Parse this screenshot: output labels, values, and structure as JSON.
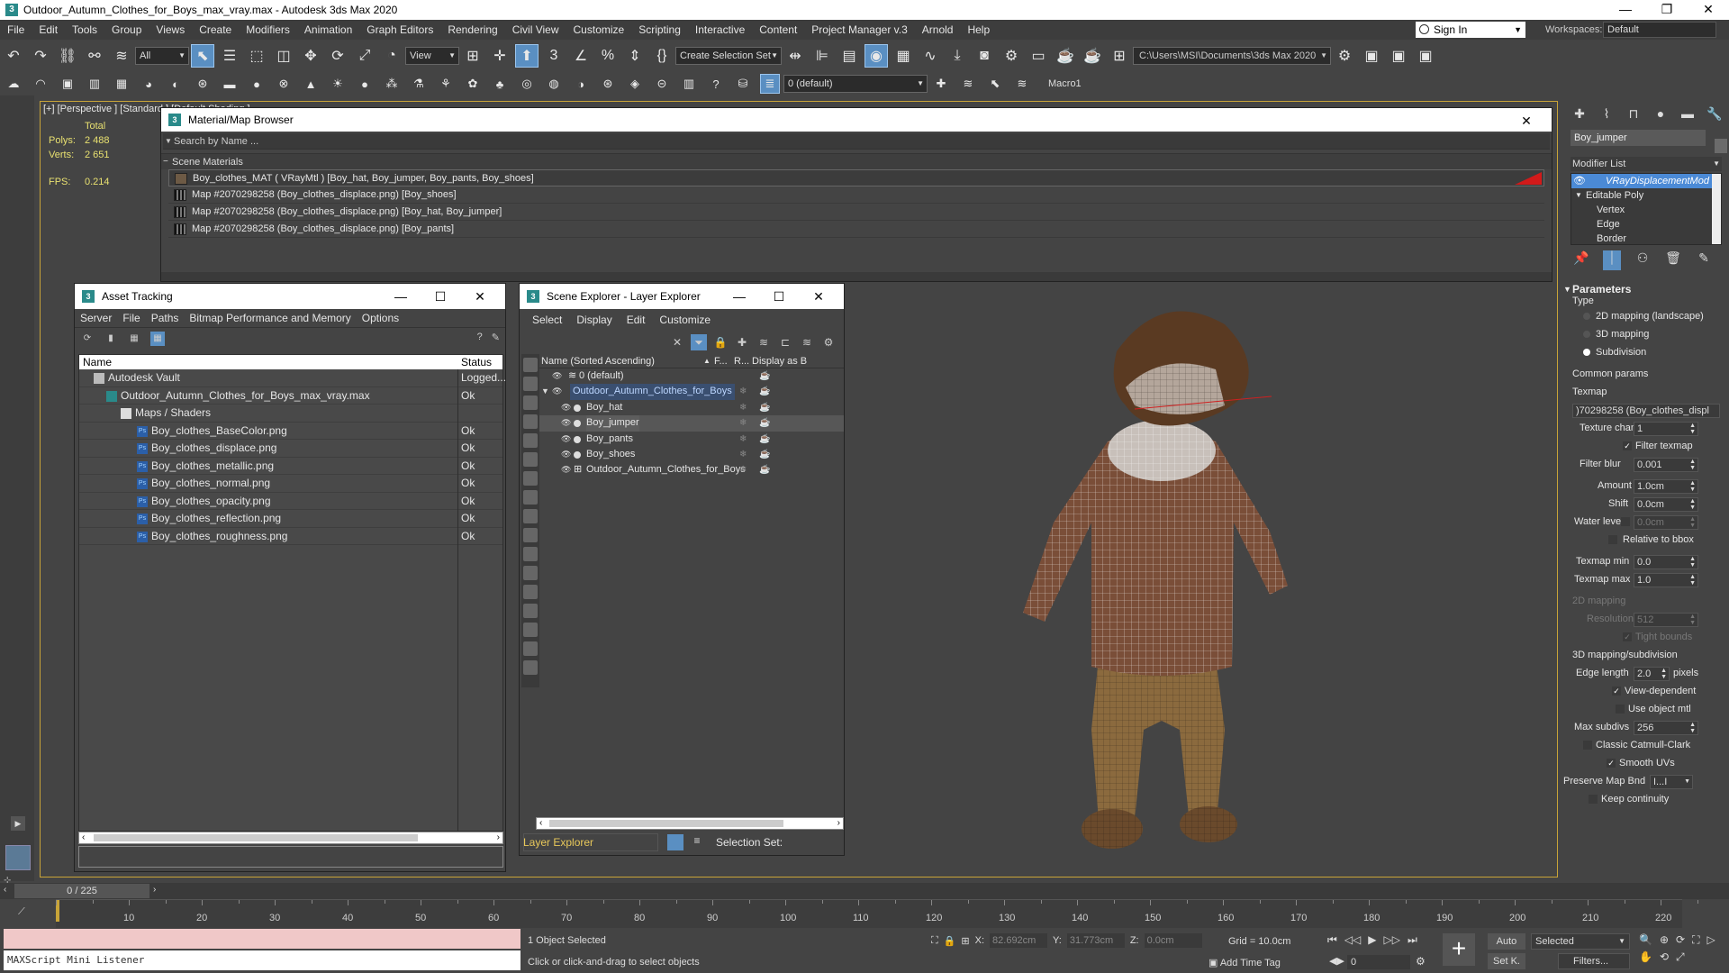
{
  "window": {
    "title": "Outdoor_Autumn_Clothes_for_Boys_max_vray.max - Autodesk 3ds Max 2020",
    "minimize": "—",
    "maximize": "❐",
    "close": "✕"
  },
  "menubar": [
    "File",
    "Edit",
    "Tools",
    "Group",
    "Views",
    "Create",
    "Modifiers",
    "Animation",
    "Graph Editors",
    "Rendering",
    "Civil View",
    "Customize",
    "Scripting",
    "Interactive",
    "Content",
    "Project Manager v.3",
    "Arnold",
    "Help"
  ],
  "signin": "Sign In",
  "workspace": {
    "label": "Workspaces:",
    "value": "Default"
  },
  "toolbar": {
    "filter_value": "All",
    "view_value": "View",
    "selection_set": "Create Selection Set",
    "path": "C:\\Users\\MSI\\Documents\\3ds Max 2020",
    "layer_value": "0 (default)",
    "macro": "Macro1"
  },
  "viewport": {
    "label": "[+] [Perspective ] [Standard ] [Default Shading ]",
    "stats": {
      "total_label": "Total",
      "polys_label": "Polys:",
      "polys": "2 488",
      "verts_label": "Verts:",
      "verts": "2 651",
      "fps_label": "FPS:",
      "fps": "0.214"
    }
  },
  "material_browser": {
    "title": "Material/Map Browser",
    "search_placeholder": "Search by Name ...",
    "section": "Scene Materials",
    "rows": [
      "Boy_clothes_MAT  ( VRayMtl )  [Boy_hat, Boy_jumper, Boy_pants, Boy_shoes]",
      "Map #2070298258 (Boy_clothes_displace.png)  [Boy_shoes]",
      "Map #2070298258 (Boy_clothes_displace.png)  [Boy_hat, Boy_jumper]",
      "Map #2070298258 (Boy_clothes_displace.png)  [Boy_pants]"
    ]
  },
  "asset_tracking": {
    "title": "Asset Tracking",
    "menu": [
      "Server",
      "File",
      "Paths",
      "Bitmap Performance and Memory",
      "Options"
    ],
    "columns": {
      "name": "Name",
      "status": "Status"
    },
    "rows": [
      {
        "name": "Autodesk Vault",
        "status": "Logged..."
      },
      {
        "name": "Outdoor_Autumn_Clothes_for_Boys_max_vray.max",
        "status": "Ok"
      },
      {
        "name": "Maps / Shaders",
        "status": ""
      },
      {
        "name": "Boy_clothes_BaseColor.png",
        "status": "Ok"
      },
      {
        "name": "Boy_clothes_displace.png",
        "status": "Ok"
      },
      {
        "name": "Boy_clothes_metallic.png",
        "status": "Ok"
      },
      {
        "name": "Boy_clothes_normal.png",
        "status": "Ok"
      },
      {
        "name": "Boy_clothes_opacity.png",
        "status": "Ok"
      },
      {
        "name": "Boy_clothes_reflection.png",
        "status": "Ok"
      },
      {
        "name": "Boy_clothes_roughness.png",
        "status": "Ok"
      }
    ]
  },
  "scene_explorer": {
    "title": "Scene Explorer - Layer Explorer",
    "menu": [
      "Select",
      "Display",
      "Edit",
      "Customize"
    ],
    "columns": {
      "name": "Name (Sorted Ascending)",
      "f": "F...",
      "r": "R...",
      "display": "Display as B"
    },
    "rows": [
      {
        "name": "0 (default)"
      },
      {
        "name": "Outdoor_Autumn_Clothes_for_Boys"
      },
      {
        "name": "Boy_hat"
      },
      {
        "name": "Boy_jumper"
      },
      {
        "name": "Boy_pants"
      },
      {
        "name": "Boy_shoes"
      },
      {
        "name": "Outdoor_Autumn_Clothes_for_Boys"
      }
    ],
    "footer": {
      "explorer": "Layer Explorer",
      "selection_set": "Selection Set:"
    }
  },
  "command_panel": {
    "object_name": "Boy_jumper",
    "modifier_list": "Modifier List",
    "stack": [
      "VRayDisplacementMod",
      "Editable Poly",
      "Vertex",
      "Edge",
      "Border"
    ],
    "parameters_title": "Parameters",
    "type_label": "Type",
    "types": [
      "2D mapping (landscape)",
      "3D mapping",
      "Subdivision"
    ],
    "common_params": "Common params",
    "texmap_label": "Texmap",
    "texmap_value": ")70298258 (Boy_clothes_displ",
    "texture_chan_label": "Texture chan",
    "texture_chan": "1",
    "filter_texmap": "Filter texmap",
    "filter_blur_label": "Filter blur",
    "filter_blur": "0.001",
    "amount_label": "Amount",
    "amount": "1.0cm",
    "shift_label": "Shift",
    "shift": "0.0cm",
    "water_level_label": "Water level",
    "water_level": "0.0cm",
    "relative_bbox": "Relative to bbox",
    "texmap_min_label": "Texmap min",
    "texmap_min": "0.0",
    "texmap_max_label": "Texmap max",
    "texmap_max": "1.0",
    "mapping2d": "2D mapping",
    "resolution_label": "Resolution",
    "resolution": "512",
    "tight_bounds": "Tight bounds",
    "mapping3d": "3D mapping/subdivision",
    "edge_length_label": "Edge length",
    "edge_length": "2.0",
    "pixels": "pixels",
    "view_dependent": "View-dependent",
    "use_object_mtl": "Use object mtl",
    "max_subdivs_label": "Max subdivs",
    "max_subdivs": "256",
    "classic_catmull": "Classic Catmull-Clark",
    "smooth_uvs": "Smooth UVs",
    "preserve_map_bnd_label": "Preserve Map Bnd",
    "preserve_map_bnd": "I...I",
    "keep_continuity": "Keep continuity"
  },
  "timeline": {
    "slider": "0 / 225",
    "ticks": [
      "10",
      "20",
      "30",
      "40",
      "50",
      "60",
      "70",
      "80",
      "90",
      "100",
      "110",
      "120",
      "130",
      "140",
      "150",
      "160",
      "170",
      "180",
      "190",
      "200",
      "210",
      "220"
    ]
  },
  "status": {
    "listener": "MAXScript Mini Listener",
    "line1": "1 Object Selected",
    "line2": "Click or click-and-drag to select objects",
    "x_label": "X:",
    "x": "82.692cm",
    "y_label": "Y:",
    "y": "31.773cm",
    "z_label": "Z:",
    "z": "0.0cm",
    "grid": "Grid = 10.0cm",
    "add_time_tag": "Add Time Tag",
    "frame": "0",
    "auto": "Auto",
    "set_k": "Set K.",
    "selected": "Selected",
    "filters": "Filters..."
  }
}
